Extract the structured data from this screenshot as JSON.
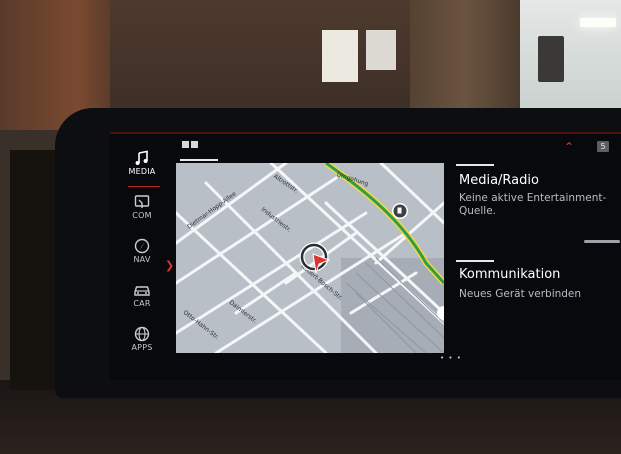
{
  "sidebar": {
    "items": [
      {
        "label": "MEDIA",
        "icon": "music-note-icon",
        "active": true
      },
      {
        "label": "COM",
        "icon": "communication-icon"
      },
      {
        "label": "NAV",
        "icon": "navigation-icon"
      },
      {
        "label": "CAR",
        "icon": "car-icon"
      },
      {
        "label": "APPS",
        "icon": "apps-globe-icon"
      }
    ]
  },
  "header": {
    "layout_icon": "split-view-icon",
    "chevron_icon": "chevron-up-icon",
    "badge": "5"
  },
  "map": {
    "streets": [
      "Dietmar-Hopp-Allee",
      "Altrottstr.",
      "Industriestr.",
      "Robert-Bosch-Str.",
      "Daimlerstr.",
      "Otto-Hahn-Str.",
      "Umgehung"
    ],
    "poi_icon": "fuel-station-icon",
    "position_icon": "vehicle-position-arrow-icon",
    "route_color": "#2f9e44",
    "highway_color": "#f2d64b"
  },
  "pager": "• • •",
  "cards": [
    {
      "title": "Media/Radio",
      "subtitle": "Keine aktive Entertainment-Quelle."
    },
    {
      "title": "Kommunikation",
      "subtitle": "Neues Gerät verbinden"
    }
  ],
  "colors": {
    "accent": "#e03131",
    "screen_bg": "#08090c",
    "map_bg": "#b9bfc7"
  }
}
